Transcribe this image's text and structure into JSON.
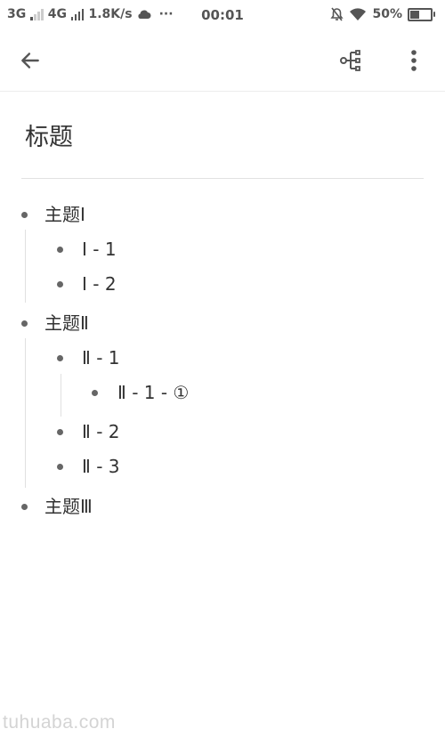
{
  "status_bar": {
    "network_1": "3G",
    "network_2": "4G",
    "speed": "1.8K/s",
    "more": "···",
    "time": "00:01",
    "battery": "50%",
    "battery_level": 0.5
  },
  "app_bar": {
    "back_icon": "arrow-left-icon",
    "mindmap_icon": "mind-map-icon",
    "more_icon": "more-vert-icon"
  },
  "document": {
    "title": "标题"
  },
  "outline": {
    "topic1": "主题Ⅰ",
    "topic1_1": "Ⅰ - 1",
    "topic1_2": "Ⅰ - 2",
    "topic2": "主题Ⅱ",
    "topic2_1": "Ⅱ - 1",
    "topic2_1_1": "Ⅱ - 1 - ①",
    "topic2_2": "Ⅱ - 2",
    "topic2_3": "Ⅱ - 3",
    "topic3": "主题Ⅲ"
  },
  "watermark": "tuhuaba.com"
}
